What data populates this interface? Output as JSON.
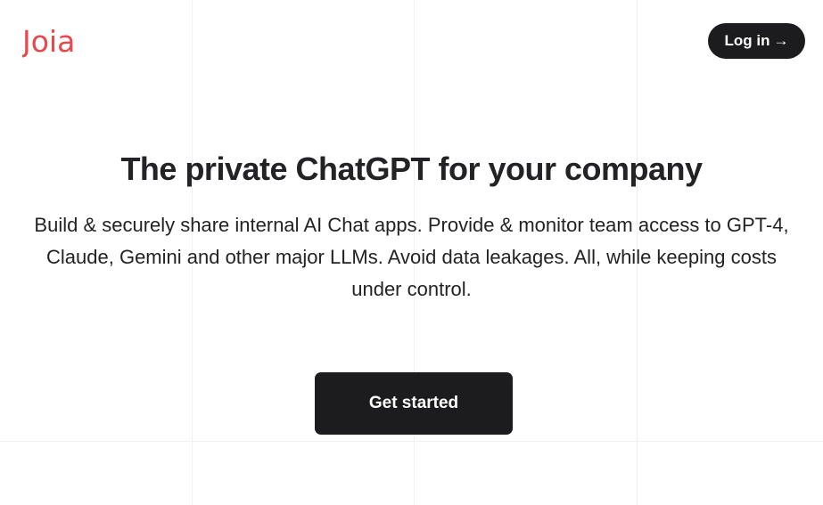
{
  "header": {
    "logo_text": "Joia",
    "login_label": "Log in",
    "login_arrow": "→"
  },
  "hero": {
    "title": "The private ChatGPT for your company",
    "subtitle": "Build & securely share internal AI Chat apps. Provide & monitor team access to GPT-4, Claude, Gemini and other major LLMs. Avoid data leakages. All, while keeping costs under control.",
    "cta_label": "Get started"
  },
  "colors": {
    "brand": "#e8474c",
    "dark": "#1c1c1e",
    "text": "#232325",
    "grid": "#f0f0f0"
  },
  "icons": {
    "login_arrow": "arrow-right-icon"
  }
}
